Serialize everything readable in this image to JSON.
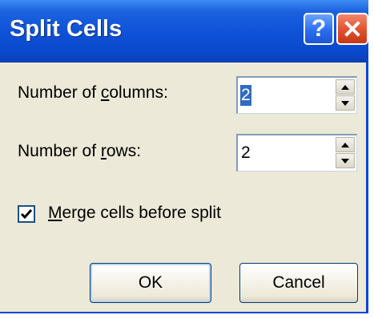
{
  "window": {
    "title": "Split Cells",
    "help_label": "?",
    "close_icon": "close-icon"
  },
  "fields": {
    "columns": {
      "label_pre": "Number of ",
      "label_key": "c",
      "label_post": "olumns:",
      "value": "2"
    },
    "rows": {
      "label_pre": "Number of ",
      "label_key": "r",
      "label_post": "ows:",
      "value": "2"
    }
  },
  "merge": {
    "key": "M",
    "label_rest": "erge cells before split",
    "checked": true
  },
  "buttons": {
    "ok": "OK",
    "cancel": "Cancel"
  },
  "colors": {
    "titlebar": "#0a49cc",
    "face": "#ece9d8",
    "close": "#e0502e",
    "selection": "#316ac5"
  }
}
